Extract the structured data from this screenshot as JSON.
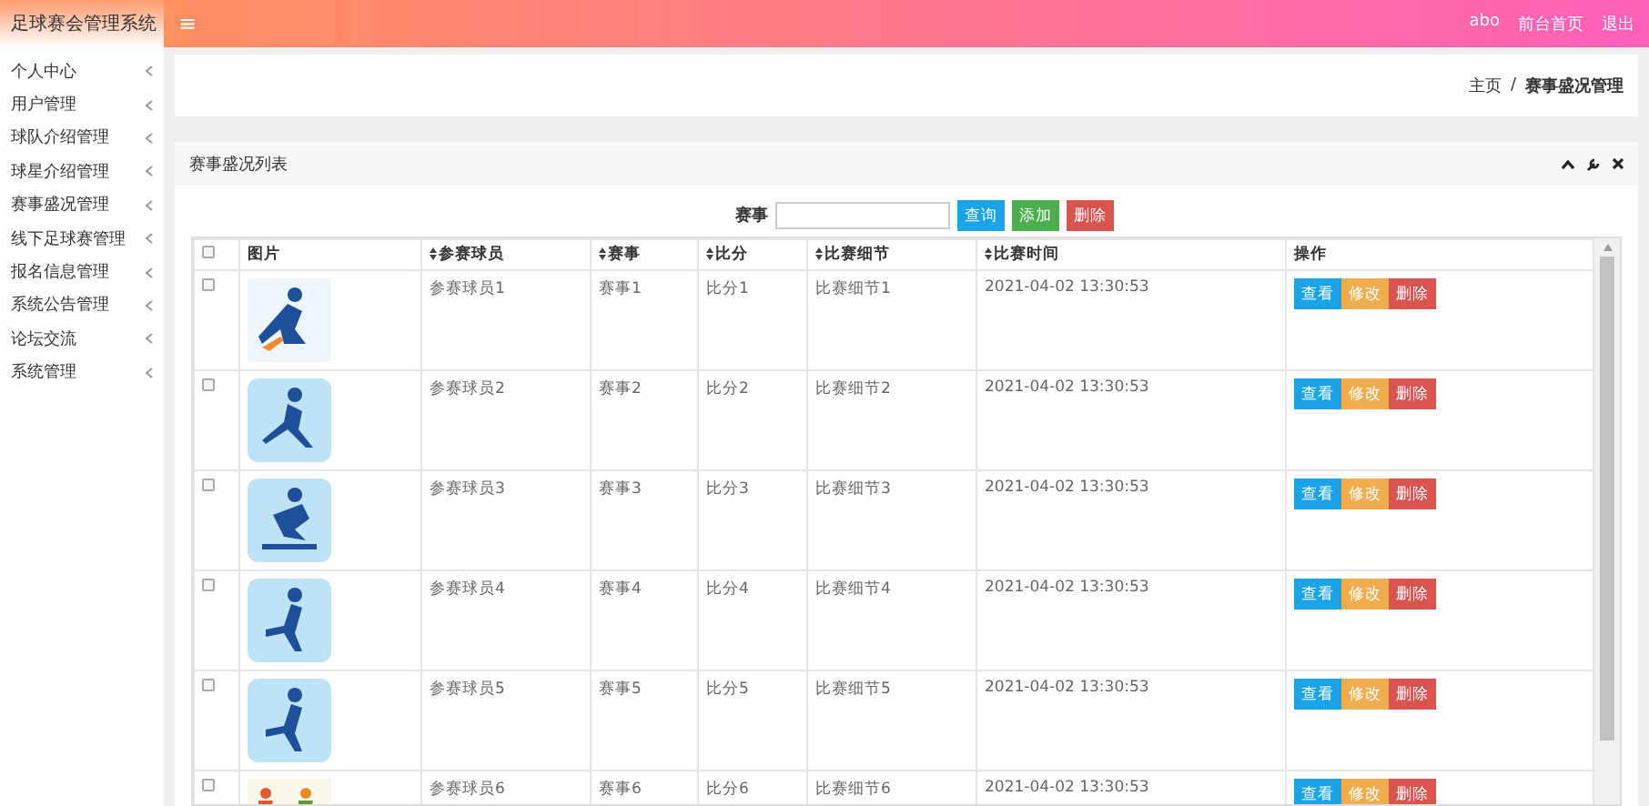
{
  "app_title": "足球赛会管理系统",
  "header": {
    "menu_icon": "≡",
    "links": [
      "abo",
      "前台首页",
      "退出"
    ]
  },
  "sidebar": {
    "items": [
      {
        "label": "个人中心",
        "expanded": false
      },
      {
        "label": "用户管理",
        "expanded": false
      },
      {
        "label": "球队介绍管理",
        "expanded": false
      },
      {
        "label": "球星介绍管理",
        "expanded": false
      },
      {
        "label": "赛事盛况管理",
        "expanded": false
      },
      {
        "label": "线下足球赛管理",
        "expanded": false
      },
      {
        "label": "报名信息管理",
        "expanded": false
      },
      {
        "label": "系统公告管理",
        "expanded": false
      },
      {
        "label": "论坛交流",
        "expanded": false
      },
      {
        "label": "系统管理",
        "expanded": false
      }
    ]
  },
  "breadcrumb": {
    "items": [
      "主页",
      "赛事盛况管理"
    ],
    "separator": "/"
  },
  "panel": {
    "title": "赛事盛况列表",
    "search": {
      "label": "赛事",
      "buttons": [
        {
          "label": "查询",
          "kind": "info"
        },
        {
          "label": "添加",
          "kind": "success"
        },
        {
          "label": "删除",
          "kind": "danger"
        }
      ]
    },
    "table": {
      "all_checked": false,
      "columns": [
        {
          "label": "图片",
          "sortable": false
        },
        {
          "label": "参赛球员",
          "sortable": true
        },
        {
          "label": "赛事",
          "sortable": true
        },
        {
          "label": "比分",
          "sortable": true
        },
        {
          "label": "比赛细节",
          "sortable": true
        },
        {
          "label": "比赛时间",
          "sortable": true
        },
        {
          "label": "操作",
          "sortable": false
        }
      ],
      "rows": [
        {
          "checked": false,
          "player": "参赛球员1",
          "event": "赛事1",
          "score": "比分1",
          "detail": "比赛细节1",
          "time": "2021-04-02 13:30:53",
          "actions": [
            {
              "label": "查看",
              "kind": "info"
            },
            {
              "label": "修改",
              "kind": "warning"
            },
            {
              "label": "删除",
              "kind": "danger"
            }
          ]
        },
        {
          "checked": false,
          "player": "参赛球员2",
          "event": "赛事2",
          "score": "比分2",
          "detail": "比赛细节2",
          "time": "2021-04-02 13:30:53",
          "actions": [
            {
              "label": "查看",
              "kind": "info"
            },
            {
              "label": "修改",
              "kind": "warning"
            },
            {
              "label": "删除",
              "kind": "danger"
            }
          ]
        },
        {
          "checked": false,
          "player": "参赛球员3",
          "event": "赛事3",
          "score": "比分3",
          "detail": "比赛细节3",
          "time": "2021-04-02 13:30:53",
          "actions": [
            {
              "label": "查看",
              "kind": "info"
            },
            {
              "label": "修改",
              "kind": "warning"
            },
            {
              "label": "删除",
              "kind": "danger"
            }
          ]
        },
        {
          "checked": false,
          "player": "参赛球员4",
          "event": "赛事4",
          "score": "比分4",
          "detail": "比赛细节4",
          "time": "2021-04-02 13:30:53",
          "actions": [
            {
              "label": "查看",
              "kind": "info"
            },
            {
              "label": "修改",
              "kind": "warning"
            },
            {
              "label": "删除",
              "kind": "danger"
            }
          ]
        },
        {
          "checked": false,
          "player": "参赛球员5",
          "event": "赛事5",
          "score": "比分5",
          "detail": "比赛细节5",
          "time": "2021-04-02 13:30:53",
          "actions": [
            {
              "label": "查看",
              "kind": "info"
            },
            {
              "label": "修改",
              "kind": "warning"
            },
            {
              "label": "删除",
              "kind": "danger"
            }
          ]
        },
        {
          "checked": false,
          "player": "参赛球员6",
          "event": "赛事6",
          "score": "比分6",
          "detail": "比赛细节6",
          "time": "2021-04-02 13:30:53",
          "actions": [
            {
              "label": "查看",
              "kind": "info"
            },
            {
              "label": "修改",
              "kind": "warning"
            },
            {
              "label": "删除",
              "kind": "danger"
            }
          ]
        }
      ]
    }
  }
}
